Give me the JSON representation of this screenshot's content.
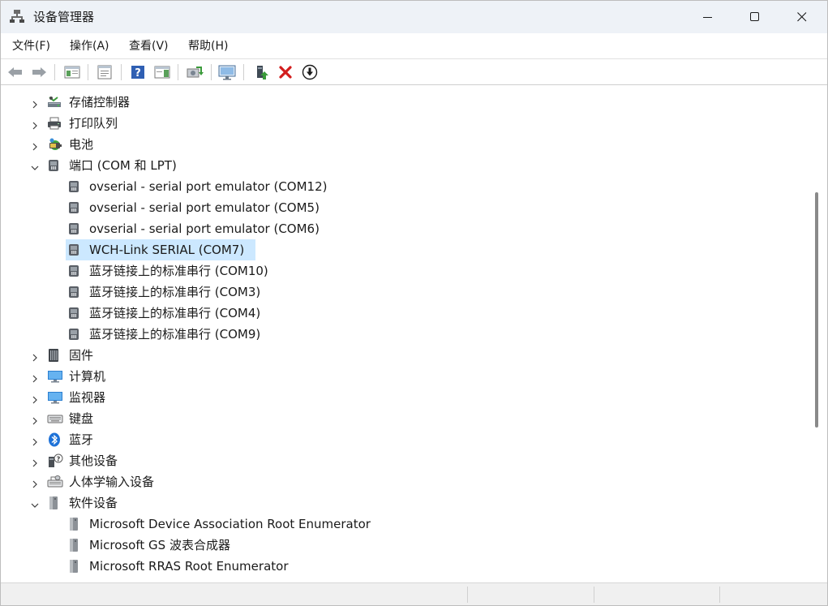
{
  "window": {
    "title": "设备管理器"
  },
  "menu": [
    "文件(F)",
    "操作(A)",
    "查看(V)",
    "帮助(H)"
  ],
  "toolbar": [
    {
      "icon": "back-arrow-icon"
    },
    {
      "icon": "forward-arrow-icon"
    },
    {
      "icon": "show-hide-console-tree-icon"
    },
    {
      "icon": "properties-icon"
    },
    {
      "icon": "help-icon"
    },
    {
      "icon": "action-pane-icon"
    },
    {
      "icon": "scan-hardware-changes-icon"
    },
    {
      "icon": "monitor-icon"
    },
    {
      "icon": "add-driver-icon"
    },
    {
      "icon": "uninstall-device-icon"
    },
    {
      "icon": "update-driver-icon"
    }
  ],
  "tree": [
    {
      "label": "存储控制器",
      "level": 0,
      "expanded": false,
      "icon": "storage-controller-icon"
    },
    {
      "label": "打印队列",
      "level": 0,
      "expanded": false,
      "icon": "printer-icon"
    },
    {
      "label": "电池",
      "level": 0,
      "expanded": false,
      "icon": "battery-icon"
    },
    {
      "label": "端口 (COM 和 LPT)",
      "level": 0,
      "expanded": true,
      "icon": "port-icon"
    },
    {
      "label": "ovserial - serial port emulator (COM12)",
      "level": 1,
      "icon": "port-icon"
    },
    {
      "label": "ovserial - serial port emulator (COM5)",
      "level": 1,
      "icon": "port-icon"
    },
    {
      "label": "ovserial - serial port emulator (COM6)",
      "level": 1,
      "icon": "port-icon"
    },
    {
      "label": "WCH-Link SERIAL (COM7)",
      "level": 1,
      "icon": "port-icon",
      "selected": true
    },
    {
      "label": "蓝牙链接上的标准串行 (COM10)",
      "level": 1,
      "icon": "port-icon"
    },
    {
      "label": "蓝牙链接上的标准串行 (COM3)",
      "level": 1,
      "icon": "port-icon"
    },
    {
      "label": "蓝牙链接上的标准串行 (COM4)",
      "level": 1,
      "icon": "port-icon"
    },
    {
      "label": "蓝牙链接上的标准串行 (COM9)",
      "level": 1,
      "icon": "port-icon"
    },
    {
      "label": "固件",
      "level": 0,
      "expanded": false,
      "icon": "firmware-icon"
    },
    {
      "label": "计算机",
      "level": 0,
      "expanded": false,
      "icon": "computer-icon"
    },
    {
      "label": "监视器",
      "level": 0,
      "expanded": false,
      "icon": "monitor-icon"
    },
    {
      "label": "键盘",
      "level": 0,
      "expanded": false,
      "icon": "keyboard-icon"
    },
    {
      "label": "蓝牙",
      "level": 0,
      "expanded": false,
      "icon": "bluetooth-icon"
    },
    {
      "label": "其他设备",
      "level": 0,
      "expanded": false,
      "icon": "unknown-device-icon"
    },
    {
      "label": "人体学输入设备",
      "level": 0,
      "expanded": false,
      "icon": "hid-icon"
    },
    {
      "label": "软件设备",
      "level": 0,
      "expanded": true,
      "icon": "software-device-icon"
    },
    {
      "label": "Microsoft Device Association Root Enumerator",
      "level": 1,
      "icon": "software-device-icon"
    },
    {
      "label": "Microsoft GS 波表合成器",
      "level": 1,
      "icon": "software-device-icon"
    },
    {
      "label": "Microsoft RRAS Root Enumerator",
      "level": 1,
      "icon": "software-device-icon"
    }
  ],
  "colors": {
    "selection": "#cce8ff",
    "titlebar": "#eef2f7",
    "accent": "#1e6fd9"
  }
}
